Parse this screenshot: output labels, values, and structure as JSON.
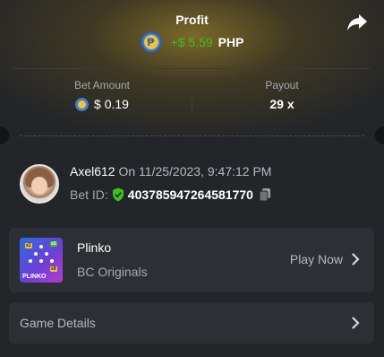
{
  "profit": {
    "title": "Profit",
    "value": "+$ 5.59",
    "currency": "PHP",
    "coin_icon": "php-coin-icon",
    "value_color": "#3bc117"
  },
  "bet_amount": {
    "label": "Bet Amount",
    "value": "$ 0.19"
  },
  "payout": {
    "label": "Payout",
    "value": "29 x"
  },
  "bet": {
    "username": "Axel612",
    "date_text": "On 11/25/2023, 9:47:12 PM",
    "bet_id_label": "Bet ID:",
    "bet_id": "403785947264581770"
  },
  "game": {
    "title": "Plinko",
    "provider": "BC Originals",
    "play_label": "Play Now",
    "thumb_text": "PLINKO"
  },
  "details": {
    "label": "Game Details"
  }
}
